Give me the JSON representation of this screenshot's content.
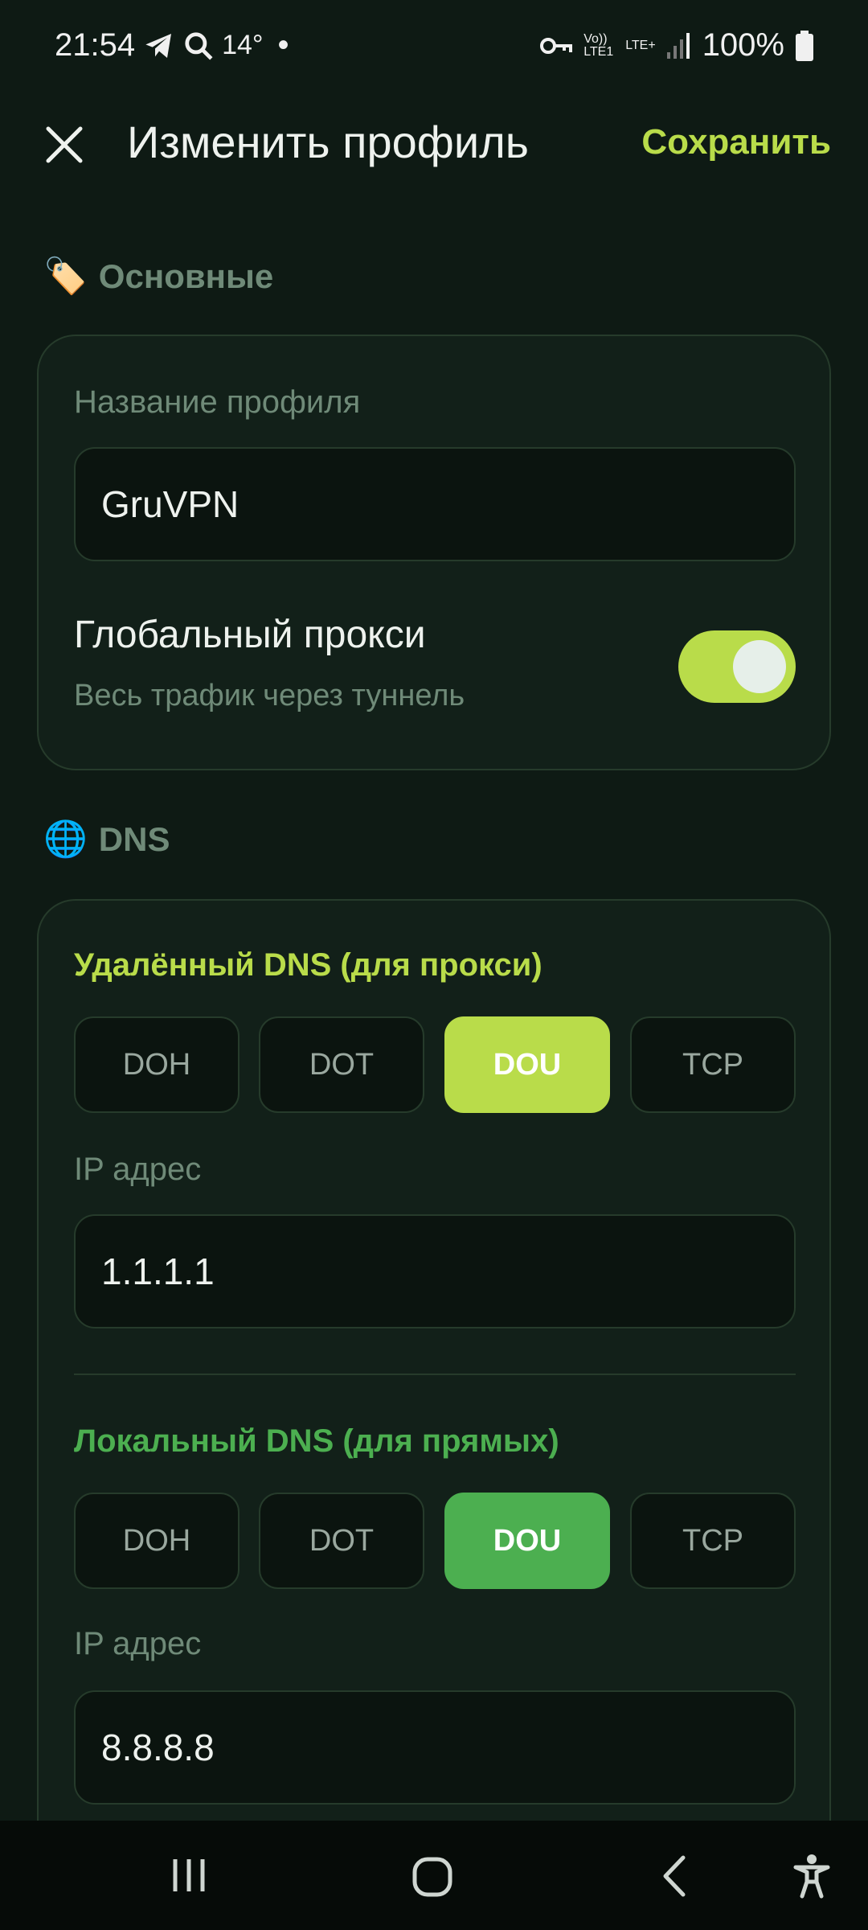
{
  "status_bar": {
    "time": "21:54",
    "temperature": "14°",
    "dot": "•",
    "battery": "100%",
    "network": "LTE+",
    "volte": "Vo)) LTE1"
  },
  "app_bar": {
    "title": "Изменить профиль",
    "save_label": "Сохранить"
  },
  "basic_section": {
    "emoji": "🏷️",
    "title": "Основные",
    "name_label": "Название профиля",
    "name_value": "GruVPN",
    "global_proxy_label": "Глобальный прокси",
    "global_proxy_desc": "Весь трафик через туннель",
    "global_proxy_on": true
  },
  "dns_section": {
    "emoji": "🌐",
    "title": "DNS",
    "remote": {
      "title": "Удалённый DNS (для прокси)",
      "options": [
        "DOH",
        "DOT",
        "DOU",
        "TCP"
      ],
      "selected": "DOU",
      "ip_label": "IP адрес",
      "ip_value": "1.1.1.1"
    },
    "local": {
      "title": "Локальный DNS (для прямых)",
      "options": [
        "DOH",
        "DOT",
        "DOU",
        "TCP"
      ],
      "selected": "DOU",
      "ip_label": "IP адрес",
      "ip_value": "8.8.8.8"
    }
  },
  "colors": {
    "background": "#0e1a14",
    "accent_lime": "#b9dc4a",
    "accent_green": "#4caf50",
    "muted_text": "#6f8a78"
  }
}
